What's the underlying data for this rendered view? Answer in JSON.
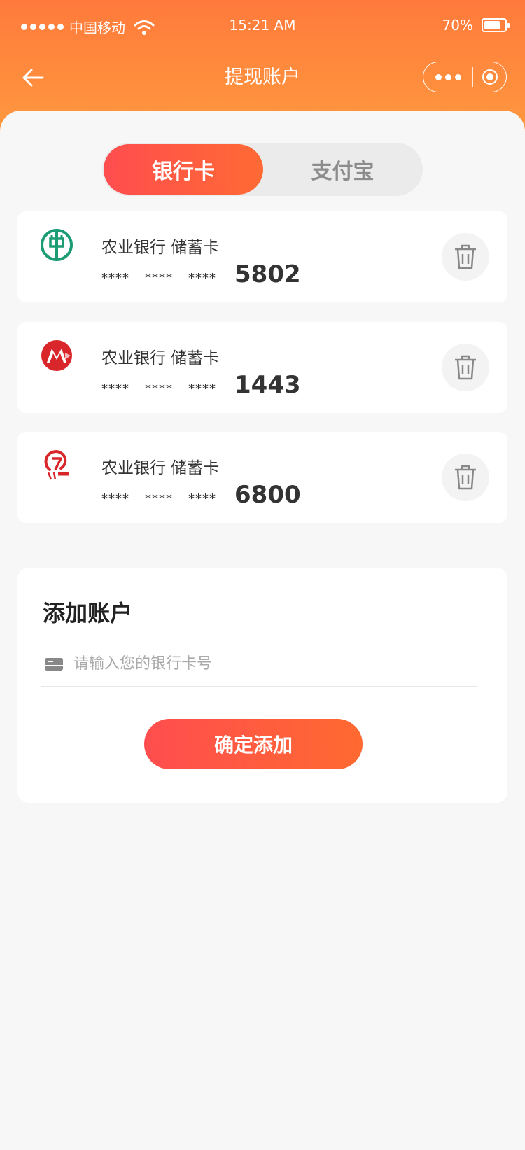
{
  "status_bar": {
    "carrier": "中国移动",
    "time": "15:21 AM",
    "battery": "70%"
  },
  "nav": {
    "title": "提现账户",
    "back_icon": "back-arrow-icon",
    "more_icon": "more-dots-icon",
    "close_icon": "target-circle-icon"
  },
  "tabs": [
    {
      "label": "银行卡",
      "active": true
    },
    {
      "label": "支付宝",
      "active": false
    }
  ],
  "cards": [
    {
      "name": "农业银行 储蓄卡",
      "mask": "****",
      "last4": "5802",
      "logo_color": "#1b9c74"
    },
    {
      "name": "农业银行 储蓄卡",
      "mask": "****",
      "last4": "1443",
      "logo_color": "#d9262b"
    },
    {
      "name": "农业银行 储蓄卡",
      "mask": "****",
      "last4": "6800",
      "logo_color": "#d9262b"
    }
  ],
  "add_account": {
    "title": "添加账户",
    "input_placeholder": "请输入您的银行卡号",
    "input_value": "",
    "confirm_label": "确定添加"
  },
  "colors": {
    "header_top": "#ff7a3c",
    "header_bottom": "#ff9a3e",
    "accent_start": "#ff4d4f",
    "accent_end": "#ff6a34",
    "background": "#f7f7f7"
  }
}
